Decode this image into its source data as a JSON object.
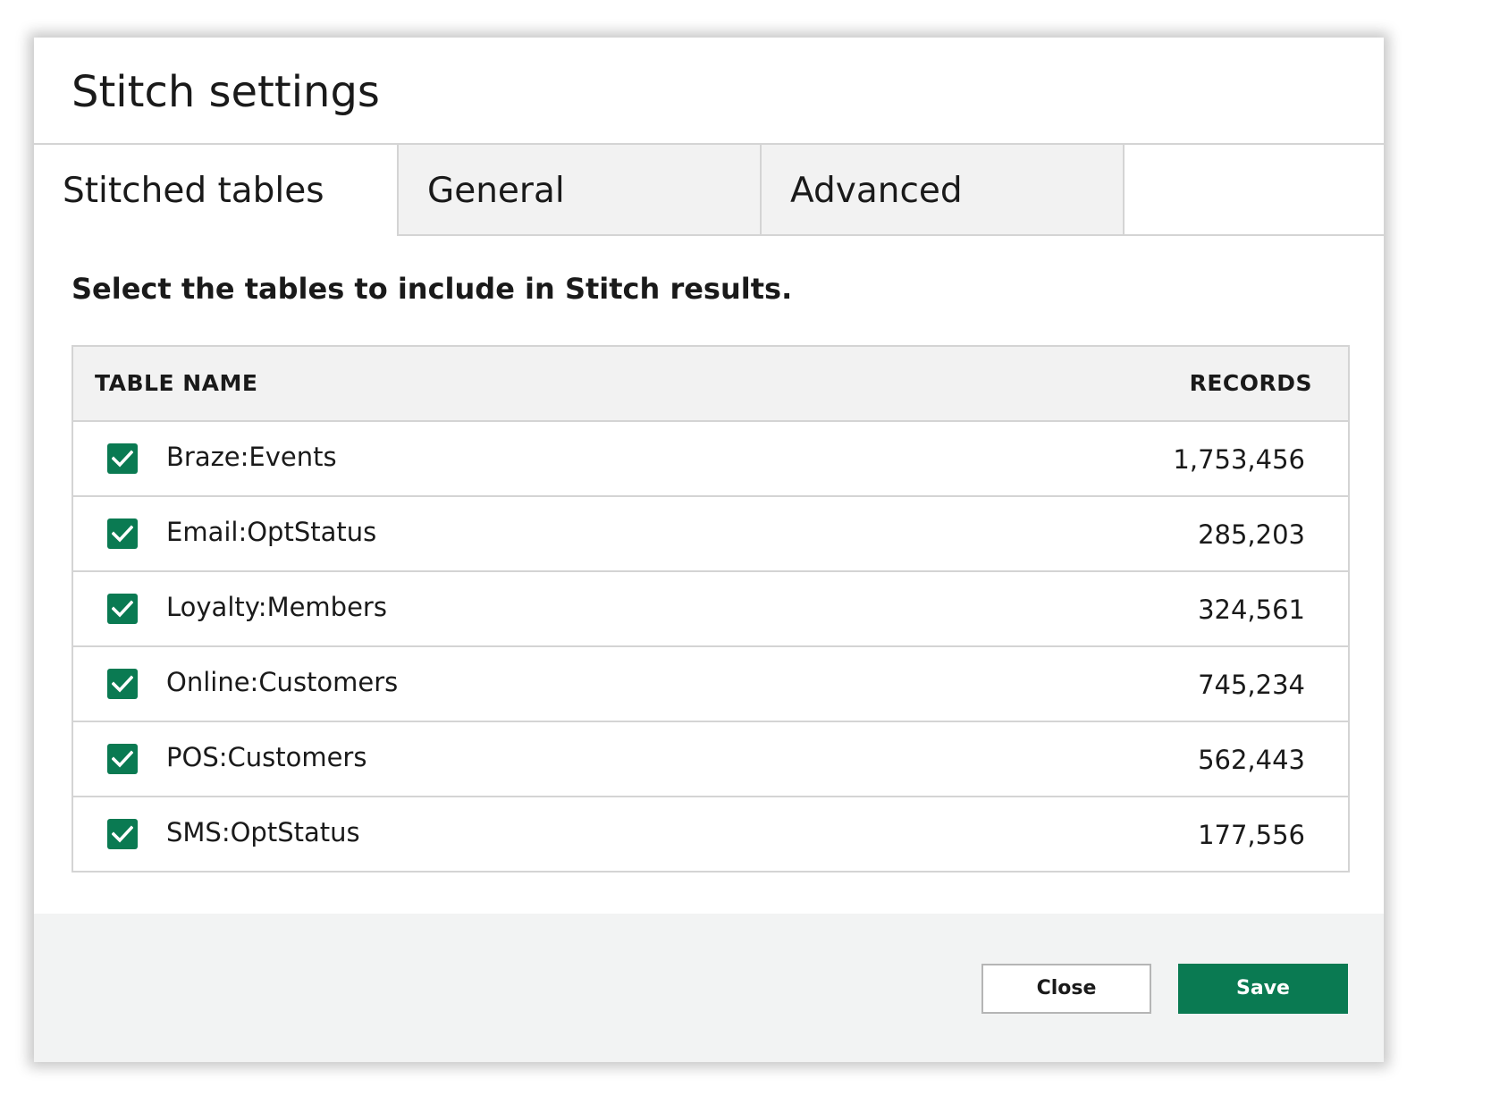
{
  "dialog": {
    "title": "Stitch settings",
    "tabs": [
      {
        "label": "Stitched tables",
        "active": true
      },
      {
        "label": "General",
        "active": false
      },
      {
        "label": "Advanced",
        "active": false
      }
    ],
    "instruction": "Select the tables to include in Stitch results.",
    "table": {
      "headers": {
        "name": "TABLE NAME",
        "records": "RECORDS"
      },
      "rows": [
        {
          "name": "Braze:Events",
          "records": "1,753,456",
          "checked": true
        },
        {
          "name": "Email:OptStatus",
          "records": "285,203",
          "checked": true
        },
        {
          "name": "Loyalty:Members",
          "records": "324,561",
          "checked": true
        },
        {
          "name": "Online:Customers",
          "records": "745,234",
          "checked": true
        },
        {
          "name": "POS:Customers",
          "records": "562,443",
          "checked": true
        },
        {
          "name": "SMS:OptStatus",
          "records": "177,556",
          "checked": true
        }
      ]
    },
    "footer": {
      "close_label": "Close",
      "save_label": "Save"
    }
  },
  "colors": {
    "accent": "#0a7a52",
    "tab_inactive_bg": "#f2f2f2",
    "footer_bg": "#f2f3f3",
    "border": "#d4d4d4"
  },
  "icons": {
    "checkbox": "check-icon"
  }
}
